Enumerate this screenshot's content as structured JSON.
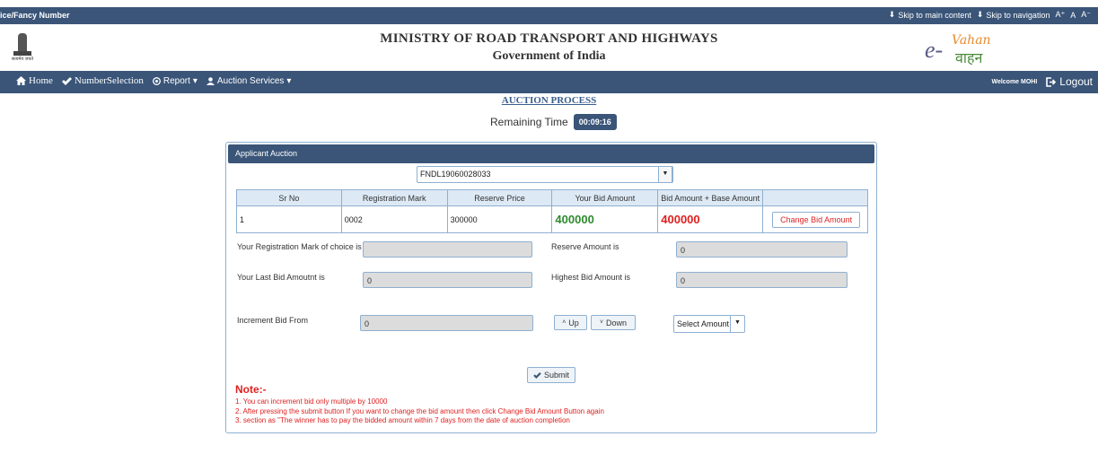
{
  "topbar": {
    "left_text": "ice/Fancy Number",
    "skip_main": "Skip to main content",
    "skip_nav": "Skip to navigation",
    "font_increase": "A⁺",
    "font_normal": "A",
    "font_decrease": "A⁻"
  },
  "header": {
    "title_line1": "MINISTRY OF ROAD TRANSPORT AND HIGHWAYS",
    "title_line2": "Government of India",
    "emblem_motto": "सत्यमेव जयते",
    "logo_e": "e-",
    "logo_vahan": "Vahan",
    "logo_vahan_hindi": "वाहन"
  },
  "nav": {
    "home": "Home",
    "number_selection": "NumberSelection",
    "report": "Report",
    "auction_services": "Auction Services",
    "welcome": "Welcome MOHI",
    "logout": "Logout"
  },
  "auction": {
    "heading": "AUCTION PROCESS",
    "remaining_label": "Remaining Time",
    "remaining_time": "00:09:16"
  },
  "panel": {
    "title": "Applicant Auction",
    "application_no": "FNDL19060028033",
    "table": {
      "headers": [
        "Sr No",
        "Registration Mark",
        "Reserve Price",
        "Your Bid Amount",
        "Bid Amount + Base Amount",
        ""
      ],
      "rows": [
        {
          "sr_no": "1",
          "registration_mark": "0002",
          "reserve_price": "300000",
          "your_bid": "400000",
          "bid_plus_base": "400000",
          "action": "Change Bid Amount"
        }
      ]
    },
    "fields": {
      "reg_mark_label": "Your Registration Mark of choice is",
      "reg_mark_value": "",
      "reserve_label": "Reserve Amount is",
      "reserve_value": "0",
      "last_bid_label": "Your Last Bid Amoutnt is",
      "last_bid_value": "0",
      "highest_label": "Highest Bid Amount is",
      "highest_value": "0",
      "increment_label": "Increment Bid From",
      "increment_value": "0"
    },
    "buttons": {
      "up": "Up",
      "down": "Down",
      "select_amount": "Select Amount",
      "submit": "Submit"
    },
    "note_title": "Note:-",
    "notes": [
      "1. You can increment bid only multiple by 10000",
      "2. After pressing the submit button If you want to change the bid amount then click Change Bid Amount Button again",
      "3. section as \"The winner has to pay the bidded amount within 7 days from the date of auction completion"
    ]
  },
  "colors": {
    "bar": "#3a5578",
    "accent_green": "#2e8b2e",
    "accent_red": "#e02020"
  }
}
